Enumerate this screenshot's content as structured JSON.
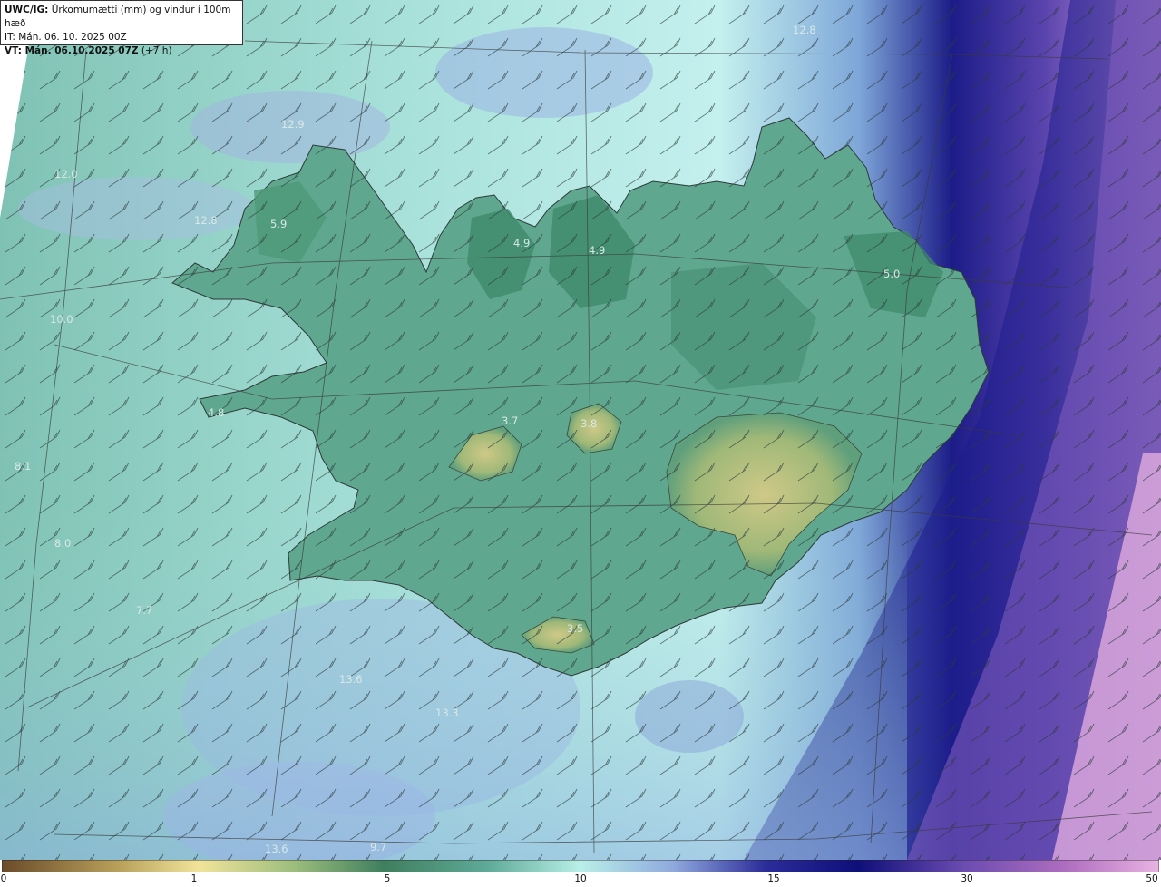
{
  "header": {
    "model": "UWC/IG:",
    "field": "Úrkomumætti (mm) og vindur í 100m hæð",
    "initial_time": "IT: Mán. 06. 10. 2025 00Z",
    "valid_label": "VT: Mán. 06.10.2025 07Z",
    "valid_offset": "(+7 h)"
  },
  "map_values": [
    {
      "id": "v1",
      "text": "12.8"
    },
    {
      "id": "v2",
      "text": "12.9"
    },
    {
      "id": "v3",
      "text": "12.0"
    },
    {
      "id": "v4",
      "text": "12.8"
    },
    {
      "id": "v5",
      "text": "5.9"
    },
    {
      "id": "v6",
      "text": "4.9"
    },
    {
      "id": "v7",
      "text": "4.9"
    },
    {
      "id": "v8",
      "text": "5.0"
    },
    {
      "id": "v9",
      "text": "4.8"
    },
    {
      "id": "v10",
      "text": "3.7"
    },
    {
      "id": "v11",
      "text": "3.8"
    },
    {
      "id": "v12",
      "text": "3.5"
    },
    {
      "id": "v13",
      "text": "13.6"
    },
    {
      "id": "v14",
      "text": "13.3"
    },
    {
      "id": "v15",
      "text": "13.6"
    },
    {
      "id": "v16",
      "text": "9.7"
    },
    {
      "id": "v17",
      "text": "7.7"
    },
    {
      "id": "v18",
      "text": "8.1"
    },
    {
      "id": "v19",
      "text": "8.0"
    },
    {
      "id": "v20",
      "text": "10.0"
    }
  ],
  "colorbar": {
    "ticks": [
      "0",
      "1",
      "5",
      "10",
      "15",
      "30",
      "50"
    ],
    "colors": [
      "#6b4b2a",
      "#b8a05a",
      "#f1e49a",
      "#9fbf7e",
      "#3f7f5e",
      "#5faa98",
      "#b9efe8",
      "#8fa9dd",
      "#2c2c9a",
      "#0f0f7a",
      "#6a4bb0",
      "#b06ec0",
      "#e9b3e2"
    ]
  }
}
